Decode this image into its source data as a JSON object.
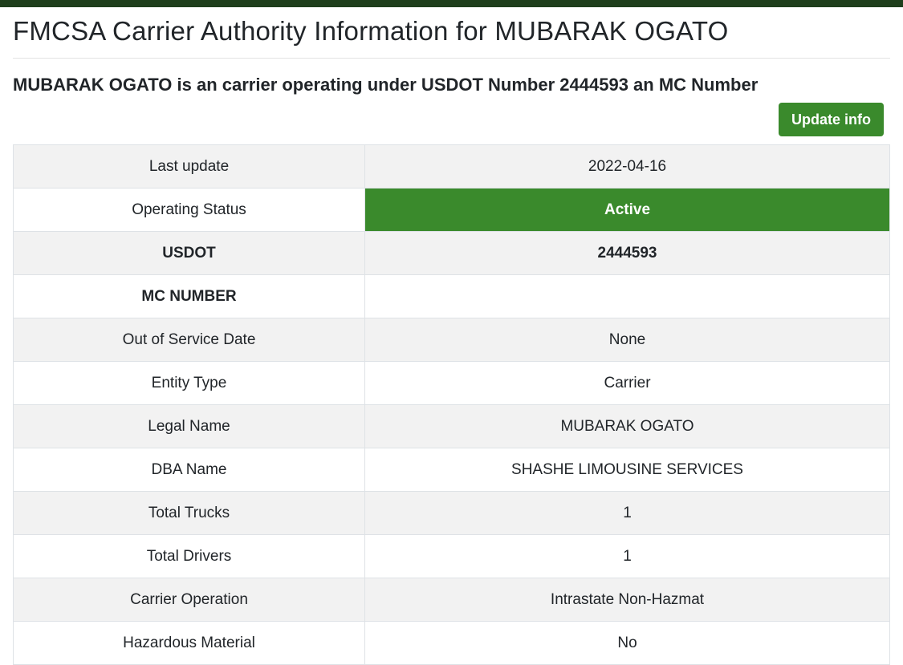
{
  "header": {
    "title": "FMCSA Carrier Authority Information for MUBARAK OGATO",
    "subtitle": "MUBARAK OGATO is an carrier operating under USDOT Number 2444593 an MC Number"
  },
  "actions": {
    "update_label": "Update info"
  },
  "colors": {
    "top_bar": "#1f3f1c",
    "accent_green": "#3a8a2c",
    "row_stripe": "#f2f2f2"
  },
  "table": {
    "rows": [
      {
        "label": "Last update",
        "value": "2022-04-16"
      },
      {
        "label": "Operating Status",
        "value": "Active"
      },
      {
        "label": "USDOT",
        "value": "2444593"
      },
      {
        "label": "MC NUMBER",
        "value": ""
      },
      {
        "label": "Out of Service Date",
        "value": "None"
      },
      {
        "label": "Entity Type",
        "value": "Carrier"
      },
      {
        "label": "Legal Name",
        "value": "MUBARAK OGATO"
      },
      {
        "label": "DBA Name",
        "value": "SHASHE LIMOUSINE SERVICES"
      },
      {
        "label": "Total Trucks",
        "value": "1"
      },
      {
        "label": "Total Drivers",
        "value": "1"
      },
      {
        "label": "Carrier Operation",
        "value": "Intrastate Non-Hazmat"
      },
      {
        "label": "Hazardous Material",
        "value": "No"
      }
    ]
  }
}
